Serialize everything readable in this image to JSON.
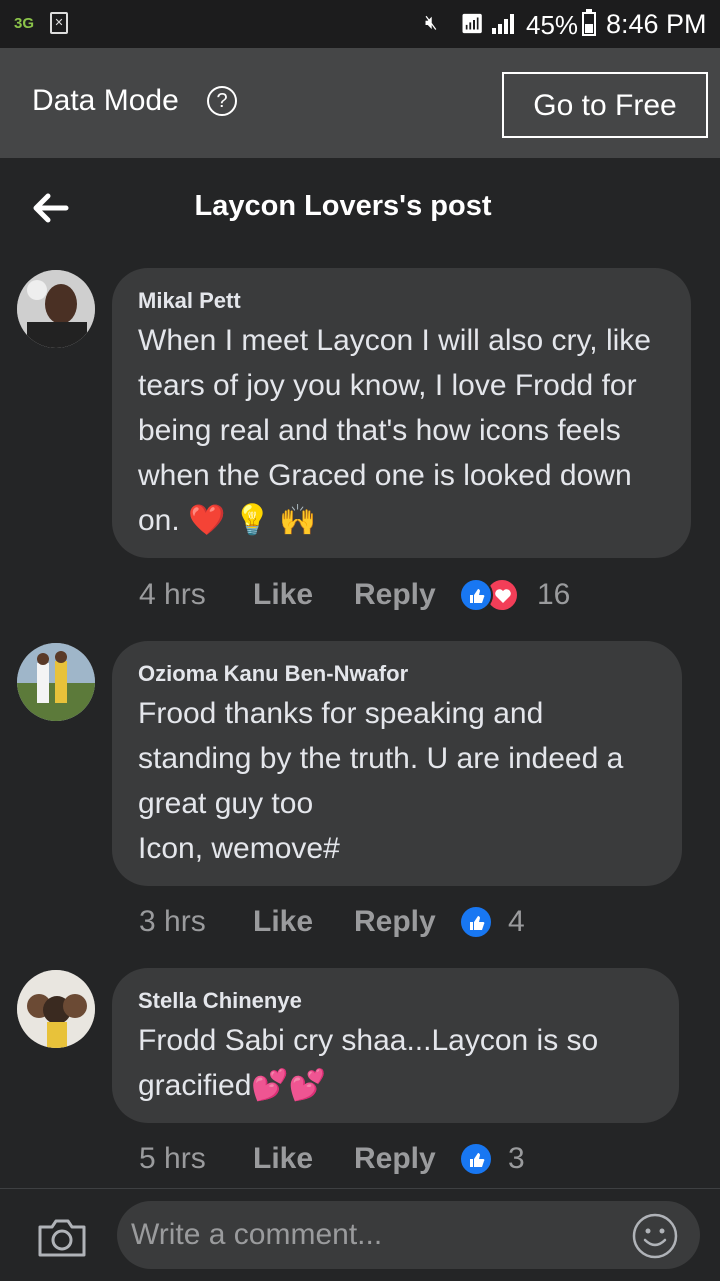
{
  "status_bar": {
    "network": "3G",
    "battery": "45%",
    "battery_level": 0.45,
    "time": "8:46 PM"
  },
  "data_mode": {
    "label": "Data Mode",
    "help_icon": "question-circle-icon",
    "go_free": "Go to Free"
  },
  "header": {
    "title": "Laycon Lovers's post",
    "back_icon": "back-arrow-icon"
  },
  "comments": [
    {
      "author": "Mikal Pett",
      "text": "When I meet Laycon I will also cry, like tears of joy you know,  I love Frodd for being real and that's how icons feels when the Graced one is looked down on. ❤️ 💡 🙌",
      "time": "4 hrs",
      "like": "Like",
      "reply": "Reply",
      "reactions": [
        "like",
        "love"
      ],
      "count": "16"
    },
    {
      "author": "Ozioma Kanu Ben-Nwafor",
      "text": "Frood thanks for speaking and standing by the truth. U are indeed a great guy too\nIcon, wemove#",
      "time": "3 hrs",
      "like": "Like",
      "reply": "Reply",
      "reactions": [
        "like"
      ],
      "count": "4"
    },
    {
      "author": "Stella Chinenye",
      "text": "Frodd Sabi cry shaa...Laycon is so gracified💕💕",
      "time": "5 hrs",
      "like": "Like",
      "reply": "Reply",
      "reactions": [
        "like"
      ],
      "count": "3"
    }
  ],
  "composer": {
    "placeholder": "Write a comment...",
    "camera_icon": "camera-icon",
    "emoji_icon": "smiley-icon"
  },
  "colors": {
    "background": "#242526",
    "bubble": "#3a3b3c",
    "banner": "#454647",
    "like_blue": "#1877f2",
    "love_red": "#f33e58"
  }
}
